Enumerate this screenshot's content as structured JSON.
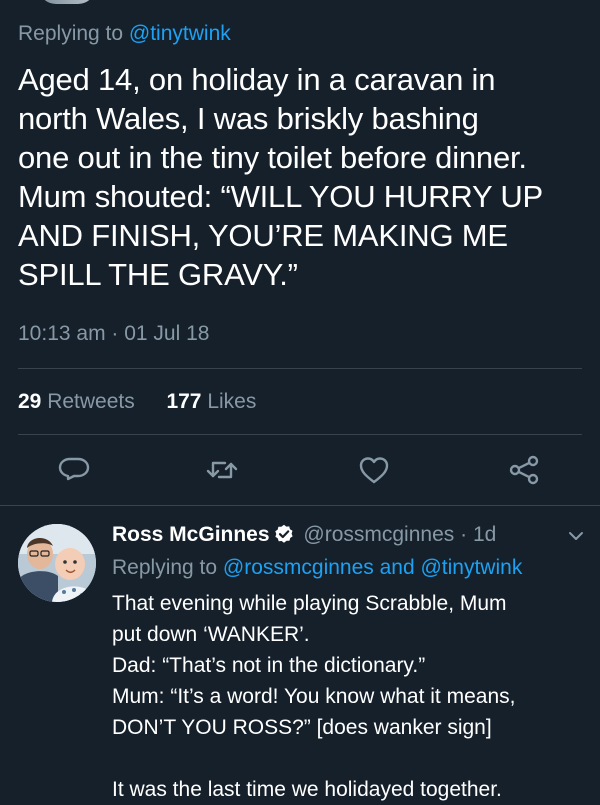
{
  "main_tweet": {
    "replying_prefix": "Replying to",
    "replying_handle": "@tinytwink",
    "text_lines": [
      "Aged 14, on holiday in a caravan in",
      "north Wales, I was briskly bashing",
      "one out in the tiny toilet before dinner.",
      "Mum shouted: “WILL YOU HURRY UP",
      "AND FINISH, YOU’RE MAKING ME",
      "SPILL THE GRAVY.”"
    ],
    "timestamp": "10:13 am · 01 Jul 18",
    "retweets_count": "29",
    "retweets_label": "Retweets",
    "likes_count": "177",
    "likes_label": "Likes"
  },
  "actions": {
    "icons": [
      "reply-icon",
      "retweet-icon",
      "like-icon",
      "share-icon"
    ]
  },
  "reply": {
    "author_name": "Ross McGinnes",
    "author_handle": "@rossmcginnes",
    "time_sep": "·",
    "age": "1d",
    "replying_prefix": "Replying to",
    "replying_handles": "@rossmcginnes and @tinytwink",
    "text_lines": [
      "That evening while playing Scrabble, Mum",
      "put down ‘WANKER’.",
      "Dad: “That’s not in the dictionary.”",
      "Mum: “It’s a word! You know what it means,",
      "DON’T YOU ROSS?” [does wanker sign]",
      "",
      "It was the last time we holidayed together."
    ]
  },
  "colors": {
    "background": "#15202b",
    "text": "#ffffff",
    "secondary_text": "#8899a6",
    "link": "#1da1f2",
    "divider": "#38444d"
  }
}
